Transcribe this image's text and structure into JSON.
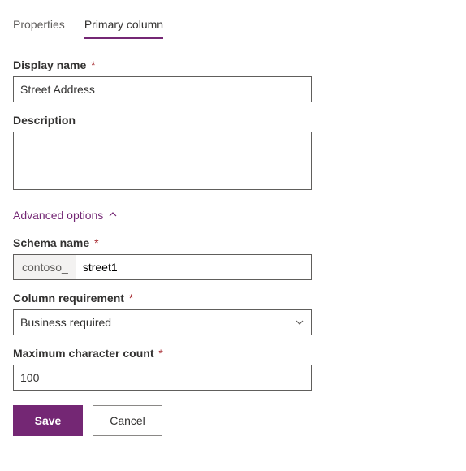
{
  "tabs": {
    "properties": "Properties",
    "primary_column": "Primary column"
  },
  "fields": {
    "display_name": {
      "label": "Display name",
      "value": "Street Address"
    },
    "description": {
      "label": "Description",
      "value": ""
    },
    "schema_name": {
      "label": "Schema name",
      "prefix": "contoso_",
      "value": "street1"
    },
    "column_requirement": {
      "label": "Column requirement",
      "value": "Business required"
    },
    "max_char_count": {
      "label": "Maximum character count",
      "value": "100"
    }
  },
  "advanced_options": {
    "label": "Advanced options"
  },
  "buttons": {
    "save": "Save",
    "cancel": "Cancel"
  },
  "required_marker": "*"
}
